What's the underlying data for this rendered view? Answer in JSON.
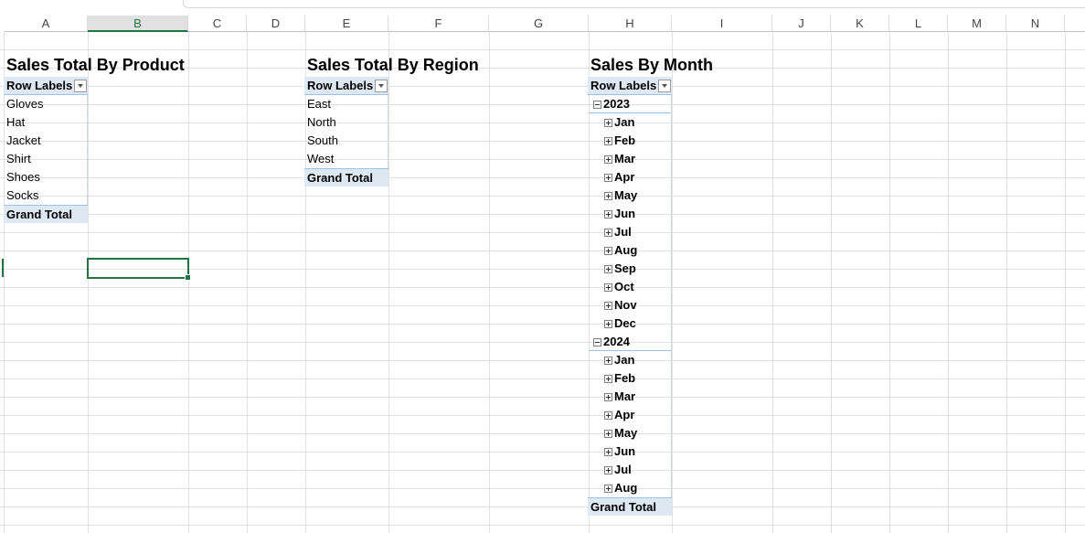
{
  "columns": [
    "A",
    "B",
    "C",
    "D",
    "E",
    "F",
    "G",
    "H",
    "I",
    "J",
    "K",
    "L",
    "M",
    "N"
  ],
  "active_column": "B",
  "pivot_product": {
    "title": "Sales Total By Product",
    "row_labels_header": "Row Labels",
    "items": [
      "Gloves",
      "Hat",
      "Jacket",
      "Shirt",
      "Shoes",
      "Socks"
    ],
    "grand_total": "Grand Total"
  },
  "pivot_region": {
    "title": "Sales Total By Region",
    "row_labels_header": "Row Labels",
    "items": [
      "East",
      "North",
      "South",
      "West"
    ],
    "grand_total": "Grand Total"
  },
  "pivot_month": {
    "title": "Sales By Month",
    "row_labels_header": "Row Labels",
    "years": [
      {
        "year": "2023",
        "months": [
          "Jan",
          "Feb",
          "Mar",
          "Apr",
          "May",
          "Jun",
          "Jul",
          "Aug",
          "Sep",
          "Oct",
          "Nov",
          "Dec"
        ]
      },
      {
        "year": "2024",
        "months": [
          "Jan",
          "Feb",
          "Mar",
          "Apr",
          "May",
          "Jun",
          "Jul",
          "Aug"
        ]
      }
    ],
    "grand_total": "Grand Total"
  },
  "colors": {
    "accent": "#217346",
    "pivot_header_bg": "#dde8f3",
    "gridline": "#e1e1e1"
  },
  "icons": {
    "filter": "dropdown-filter-icon",
    "expand": "plus-box-icon",
    "collapse": "minus-box-icon"
  }
}
